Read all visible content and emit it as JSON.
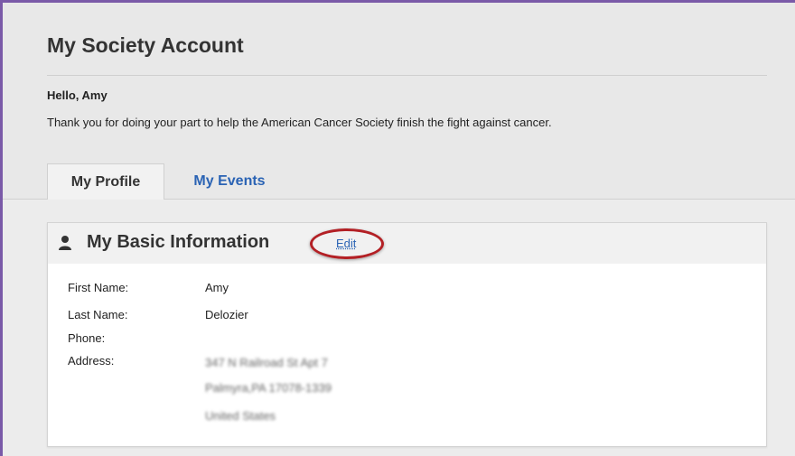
{
  "page": {
    "title": "My Society Account",
    "greeting": "Hello, Amy",
    "intro": "Thank you for doing your part to help the American Cancer Society finish the fight against cancer."
  },
  "tabs": [
    {
      "label": "My Profile",
      "active": true
    },
    {
      "label": "My Events",
      "active": false
    }
  ],
  "basic_info": {
    "title": "My Basic Information",
    "edit_label": "Edit",
    "icon": "person-icon",
    "fields": [
      {
        "label": "First Name:",
        "value": "Amy"
      },
      {
        "label": "Last Name:",
        "value": "Delozier"
      },
      {
        "label": "Phone:",
        "value": ""
      },
      {
        "label": "Address:",
        "value": "347 N Railroad St Apt 7"
      }
    ],
    "address_lines": [
      "Palmyra,PA 17078-1339",
      "United States"
    ]
  },
  "colors": {
    "accent_link": "#2a63b4",
    "highlight_ring": "#b32025",
    "frame_border": "#7a5aa8"
  }
}
